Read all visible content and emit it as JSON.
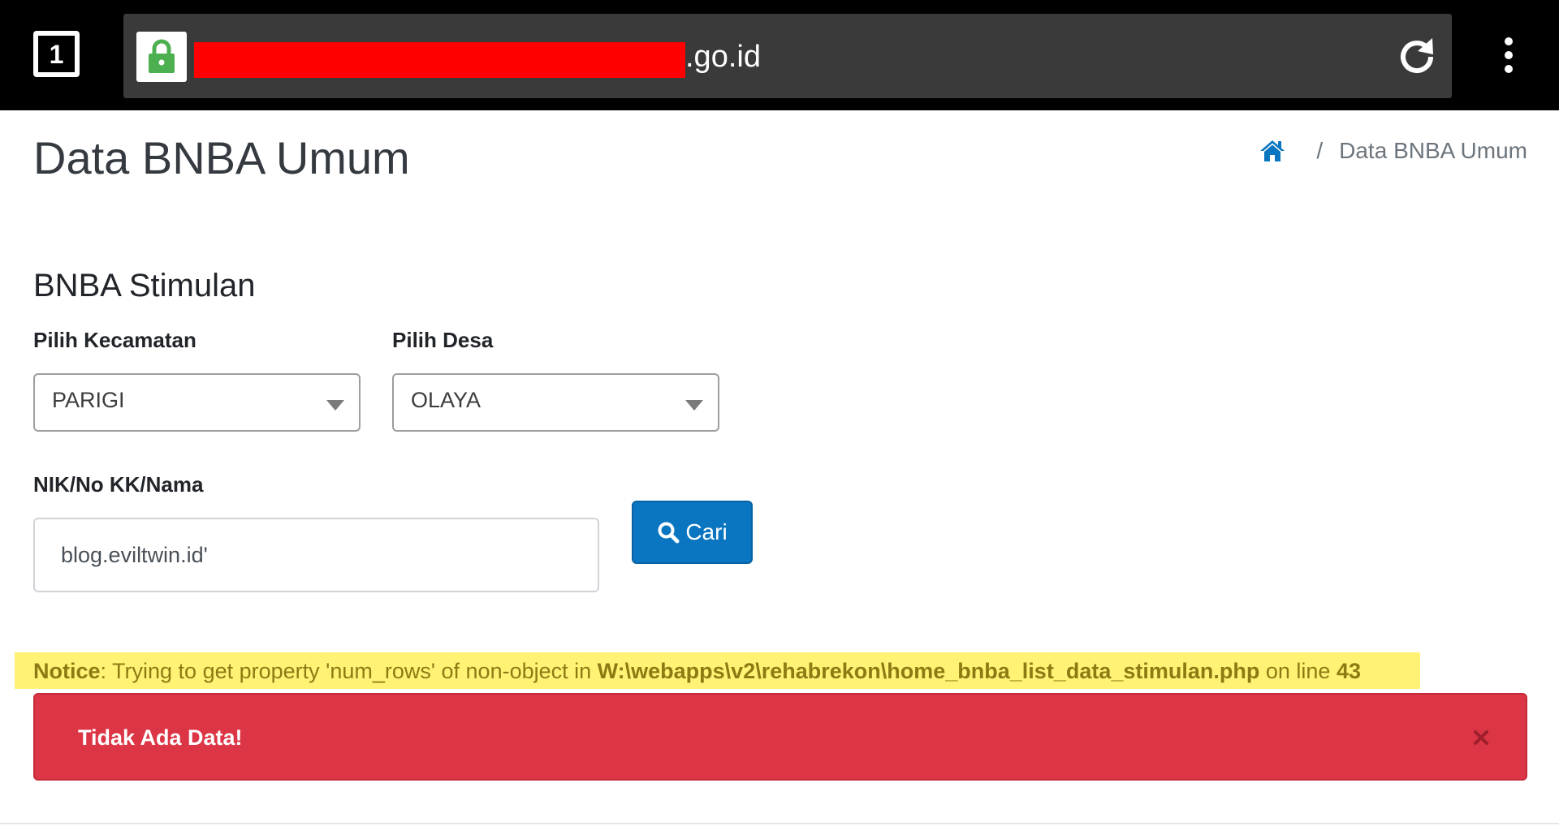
{
  "browser": {
    "tab_count": "1",
    "url_suffix": ".go.id",
    "icons": {
      "lock": "lock-icon",
      "reload": "reload-icon",
      "menu": "more-vert-icon"
    }
  },
  "header": {
    "title": "Data BNBA Umum",
    "breadcrumb": {
      "home_icon": "home-icon",
      "separator": "/",
      "current": "Data BNBA Umum"
    }
  },
  "form": {
    "section_title": "BNBA Stimulan",
    "kecamatan": {
      "label": "Pilih Kecamatan",
      "value": "PARIGI"
    },
    "desa": {
      "label": "Pilih Desa",
      "value": "OLAYA"
    },
    "search": {
      "label": "NIK/No KK/Nama",
      "value": "blog.eviltwin.id'"
    },
    "button_label": "Cari"
  },
  "notice": {
    "prefix": "Notice",
    "message": ": Trying to get property 'num_rows' of non-object in ",
    "file": "W:\\webapps\\v2\\rehabrekon\\home_bnba_list_data_stimulan.php",
    "on_line_text": " on line ",
    "line": "43"
  },
  "alert": {
    "message": "Tidak Ada Data!",
    "close_icon": "close-icon"
  },
  "colors": {
    "chrome_bg": "#000000",
    "urlbar_bg": "#3a3a3a",
    "lock_green": "#4caf50",
    "redaction": "#ff0000",
    "primary": "#0a75c0",
    "notice_bg": "#fff275",
    "notice_text": "#8a7c12",
    "danger": "#dc3545"
  }
}
